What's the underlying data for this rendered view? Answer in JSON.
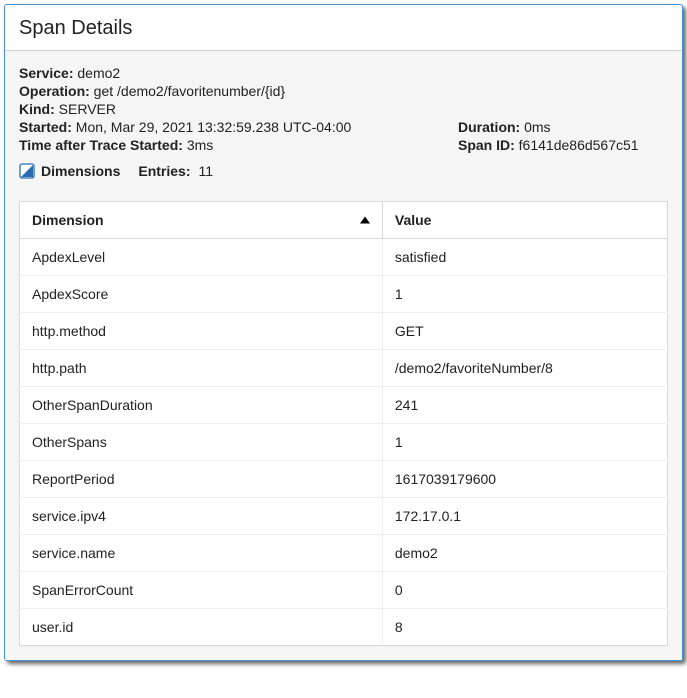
{
  "title": "Span Details",
  "meta": {
    "service_label": "Service:",
    "service_value": "demo2",
    "operation_label": "Operation:",
    "operation_value": "get /demo2/favoritenumber/{id}",
    "kind_label": "Kind:",
    "kind_value": "SERVER",
    "started_label": "Started:",
    "started_value": "Mon, Mar 29, 2021 13:32:59.238 UTC-04:00",
    "time_after_label": "Time after Trace Started:",
    "time_after_value": "3ms",
    "duration_label": "Duration:",
    "duration_value": "0ms",
    "span_id_label": "Span ID:",
    "span_id_value": "f6141de86d567c51"
  },
  "tabs": {
    "dimensions": "Dimensions",
    "entries_label": "Entries:",
    "entries_count": "11"
  },
  "table": {
    "header_dimension": "Dimension",
    "header_value": "Value",
    "rows": [
      {
        "dim": "ApdexLevel",
        "val": "satisfied"
      },
      {
        "dim": "ApdexScore",
        "val": "1"
      },
      {
        "dim": "http.method",
        "val": "GET"
      },
      {
        "dim": "http.path",
        "val": "/demo2/favoriteNumber/8"
      },
      {
        "dim": "OtherSpanDuration",
        "val": "241"
      },
      {
        "dim": "OtherSpans",
        "val": "1"
      },
      {
        "dim": "ReportPeriod",
        "val": "1617039179600"
      },
      {
        "dim": "service.ipv4",
        "val": "172.17.0.1"
      },
      {
        "dim": "service.name",
        "val": "demo2"
      },
      {
        "dim": "SpanErrorCount",
        "val": "0"
      },
      {
        "dim": "user.id",
        "val": "8"
      }
    ]
  }
}
